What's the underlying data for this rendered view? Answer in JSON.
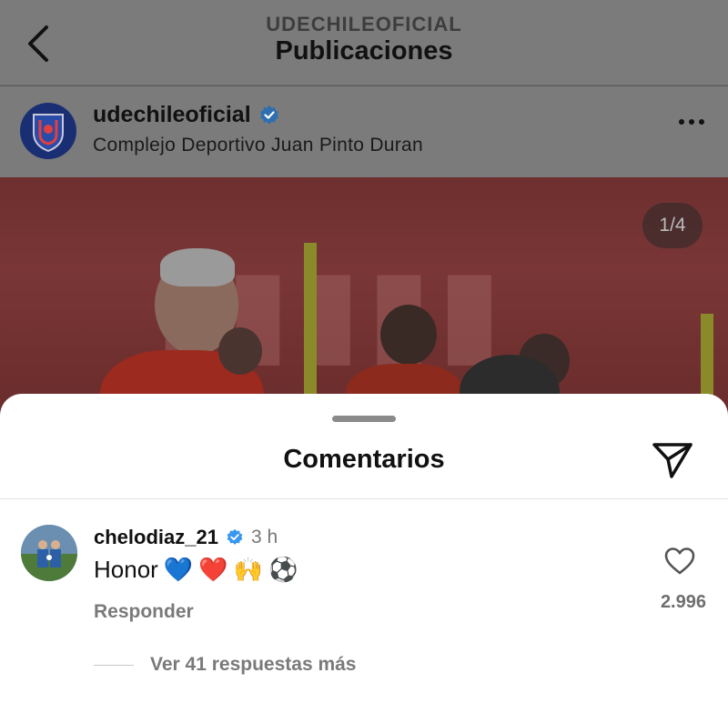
{
  "header": {
    "subtitle": "UDECHILEOFICIAL",
    "title": "Publicaciones"
  },
  "post": {
    "username": "udechileoficial",
    "location": "Complejo Deportivo Juan Pinto Duran",
    "image_counter": "1/4"
  },
  "comments_sheet": {
    "title": "Comentarios",
    "comment": {
      "username": "chelodiaz_21",
      "time": "3 h",
      "text": "Honor",
      "emojis": [
        "💙",
        "❤️",
        "🙌",
        "⚽"
      ],
      "reply_label": "Responder",
      "like_count": "2.996",
      "view_replies": "Ver 41 respuestas más"
    }
  },
  "colors": {
    "verified": "#3897f0",
    "overlay": "#7b7b7b",
    "sheet_bg": "#ffffff"
  },
  "icons": {
    "back": "chevron-left-icon",
    "verified": "verified-badge-icon",
    "more": "more-horizontal-icon",
    "share": "paper-plane-icon",
    "like": "heart-outline-icon"
  }
}
